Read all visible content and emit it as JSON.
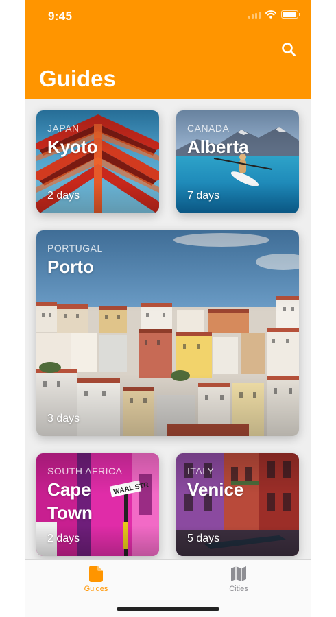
{
  "status_bar": {
    "time": "9:45",
    "battery_level": 0.95
  },
  "header": {
    "title": "Guides",
    "search_icon": "search-icon"
  },
  "guides": [
    {
      "country": "JAPAN",
      "city": "Kyoto",
      "days": "2 days"
    },
    {
      "country": "CANADA",
      "city": "Alberta",
      "days": "7 days"
    },
    {
      "country": "PORTUGAL",
      "city": "Porto",
      "days": "3 days"
    },
    {
      "country": "SOUTH AFRICA",
      "city": "Cape Town",
      "days": "2 days"
    },
    {
      "country": "ITALY",
      "city": "Venice",
      "days": "5 days"
    }
  ],
  "tab_bar": {
    "tabs": [
      {
        "label": "Guides",
        "icon": "document-icon",
        "selected": true
      },
      {
        "label": "Cities",
        "icon": "map-icon",
        "selected": false
      }
    ]
  },
  "colors": {
    "accent": "#ff9500",
    "tab_inactive": "#8e8e93",
    "background": "#efefef"
  }
}
